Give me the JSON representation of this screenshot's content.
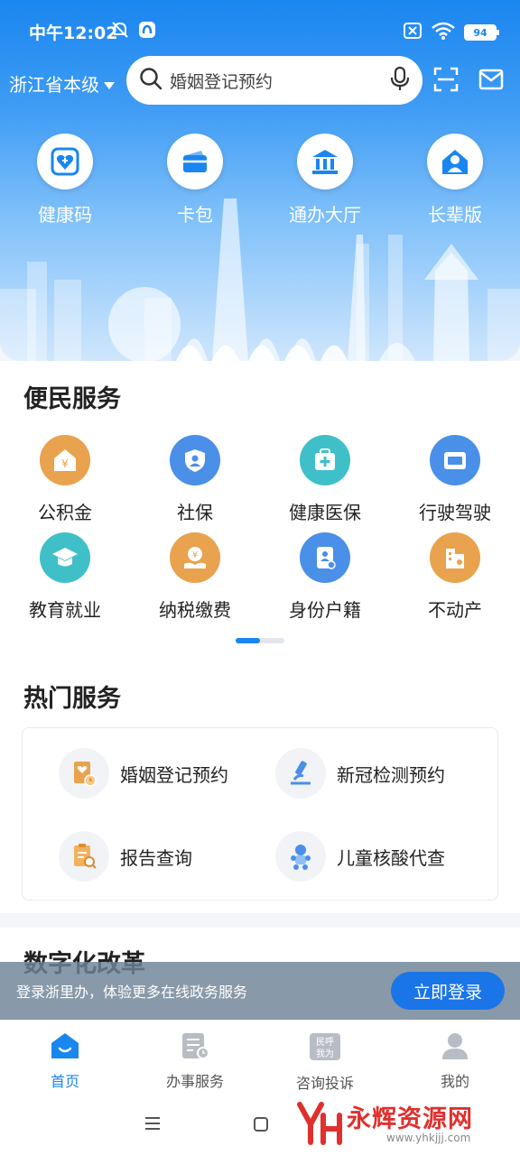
{
  "status": {
    "time": "中午12:02",
    "battery": "94",
    "icons": [
      "mute-icon",
      "app-notify-icon",
      "nosim-icon",
      "wifi-icon",
      "battery-icon"
    ]
  },
  "header": {
    "region": "浙江省本级",
    "search_placeholder": "婚姻登记预约",
    "icons": [
      "search-icon",
      "mic-icon",
      "scan-icon",
      "mail-icon"
    ]
  },
  "quick_actions": [
    {
      "label": "健康码",
      "icon": "health-code-icon"
    },
    {
      "label": "卡包",
      "icon": "wallet-icon"
    },
    {
      "label": "通办大厅",
      "icon": "hall-icon"
    },
    {
      "label": "长辈版",
      "icon": "elder-icon"
    }
  ],
  "convenience": {
    "title": "便民服务",
    "items": [
      {
        "label": "公积金",
        "icon": "housing-fund-icon",
        "color": "#e9a24d"
      },
      {
        "label": "社保",
        "icon": "social-security-icon",
        "color": "#4a8fe8"
      },
      {
        "label": "健康医保",
        "icon": "medical-insurance-icon",
        "color": "#3fc0c8"
      },
      {
        "label": "行驶驾驶",
        "icon": "driving-license-icon",
        "color": "#4a8fe8"
      },
      {
        "label": "教育就业",
        "icon": "education-icon",
        "color": "#3fc0c8"
      },
      {
        "label": "纳税缴费",
        "icon": "tax-icon",
        "color": "#e9a24d"
      },
      {
        "label": "身份户籍",
        "icon": "id-card-icon",
        "color": "#4a8fe8"
      },
      {
        "label": "不动产",
        "icon": "real-estate-icon",
        "color": "#e9a24d"
      }
    ],
    "page_index": 1,
    "page_count": 2
  },
  "hot": {
    "title": "热门服务",
    "items": [
      {
        "label": "婚姻登记预约",
        "icon": "marriage-icon"
      },
      {
        "label": "新冠检测预约",
        "icon": "microscope-icon"
      },
      {
        "label": "报告查询",
        "icon": "report-search-icon"
      },
      {
        "label": "儿童核酸代查",
        "icon": "child-icon"
      }
    ]
  },
  "digital": {
    "title": "数字化改革"
  },
  "login_banner": {
    "text": "登录浙里办，体验更多在线政务服务",
    "button": "立即登录"
  },
  "tabs": [
    {
      "label": "首页",
      "icon": "home-icon",
      "active": true
    },
    {
      "label": "办事服务",
      "icon": "service-doc-icon",
      "active": false
    },
    {
      "label": "咨询投诉",
      "icon": "complaint-icon",
      "active": false,
      "badge_text": "民呼我为"
    },
    {
      "label": "我的",
      "icon": "profile-icon",
      "active": false
    }
  ],
  "watermark": {
    "text": "永辉资源网",
    "url": "www.yhkjjj.com"
  },
  "colors": {
    "brand": "#1a86f0",
    "button": "#1a75e8",
    "orange": "#e9a24d",
    "teal": "#3fc0c8"
  }
}
